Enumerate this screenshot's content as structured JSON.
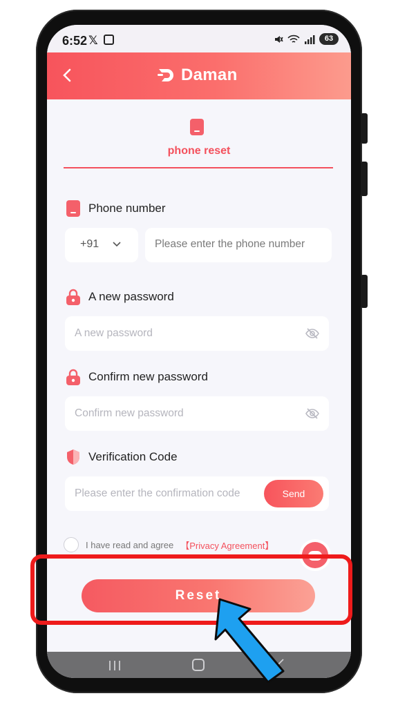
{
  "status_bar": {
    "time": "6:52",
    "x_glyph": "𝕏",
    "battery": "63",
    "icons": [
      "mute-icon",
      "wifi-icon",
      "signal-icon"
    ]
  },
  "header": {
    "back_icon": "chevron-left-icon",
    "logo_text": "Daman"
  },
  "tab": {
    "label": "phone reset",
    "icon": "phone-icon"
  },
  "form": {
    "phone": {
      "label": "Phone number",
      "country_code": "+91",
      "placeholder": "Please enter the phone number"
    },
    "new_password": {
      "label": "A new password",
      "placeholder": "A new password"
    },
    "confirm_password": {
      "label": "Confirm new password",
      "placeholder": "Confirm new password"
    },
    "verification": {
      "label": "Verification Code",
      "placeholder": "Please enter the confirmation code",
      "send_label": "Send"
    },
    "agreement": {
      "text": "I have read and agree",
      "link": "【Privacy Agreement】"
    },
    "reset_label": "Reset"
  },
  "colors": {
    "brand": "#f4505c",
    "annotation_box": "#ee1b1b",
    "annotation_arrow": "#1ea0f0"
  }
}
